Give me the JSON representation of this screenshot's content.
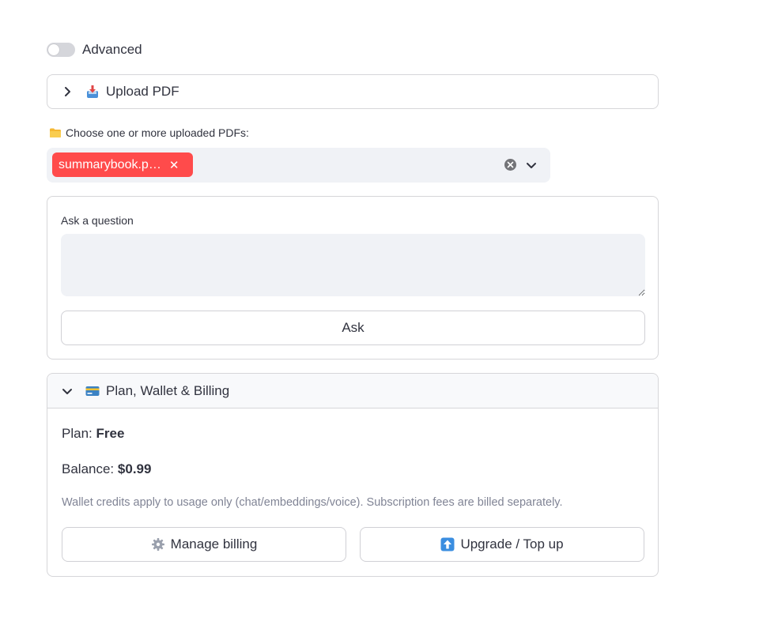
{
  "advanced": {
    "label": "Advanced",
    "enabled": false
  },
  "upload": {
    "title": "Upload PDF",
    "icon": "inbox-tray-icon",
    "expanded": false
  },
  "pdf_select": {
    "label": "Choose one or more uploaded PDFs:",
    "label_icon": "folder-icon",
    "selected": [
      "summarybook.p…"
    ]
  },
  "question": {
    "label": "Ask a question",
    "value": "",
    "ask_label": "Ask"
  },
  "billing": {
    "title": "Plan, Wallet & Billing",
    "icon": "credit-card-icon",
    "expanded": true,
    "plan_label": "Plan:",
    "plan_value": "Free",
    "balance_label": "Balance:",
    "balance_value": "$0.99",
    "note": "Wallet credits apply to usage only (chat/embeddings/voice). Subscription fees are billed separately.",
    "manage_label": "Manage billing",
    "upgrade_label": "Upgrade / Top up"
  },
  "colors": {
    "accent": "#ff4b4b",
    "input_bg": "#f0f2f6",
    "border": "#d6d6d9",
    "text": "#31333f",
    "muted": "#808495"
  }
}
